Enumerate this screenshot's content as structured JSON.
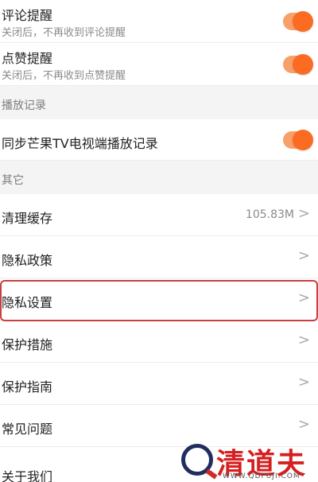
{
  "notifications": {
    "comment": {
      "title": "评论提醒",
      "subtitle": "关闭后，不再收到评论提醒",
      "enabled": true
    },
    "like": {
      "title": "点赞提醒",
      "subtitle": "关闭后，不再收到点赞提醒",
      "enabled": true
    }
  },
  "playback_section": {
    "header": "播放记录",
    "sync": {
      "title": "同步芒果TV电视端播放记录",
      "enabled": true
    }
  },
  "other_section": {
    "header": "其它",
    "items": [
      {
        "label": "清理缓存",
        "value": "105.83M"
      },
      {
        "label": "隐私政策"
      },
      {
        "label": "隐私设置"
      },
      {
        "label": "保护措施"
      },
      {
        "label": "保护指南"
      },
      {
        "label": "常见问题"
      },
      {
        "label": "关于我们"
      }
    ]
  },
  "chevron": ">",
  "watermark": {
    "text": "清道夫",
    "url": "WWW.QDFUJI.COM"
  },
  "colors": {
    "accent": "#fb6b22",
    "highlight": "#c94040"
  }
}
